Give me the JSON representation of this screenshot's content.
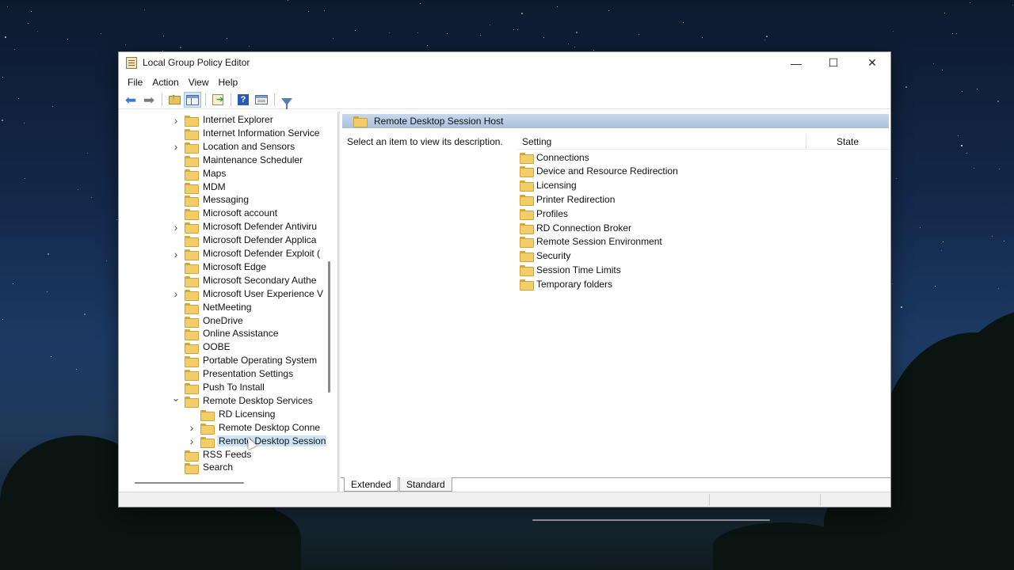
{
  "window": {
    "title": "Local Group Policy Editor",
    "controls": {
      "minimize": "—",
      "maximize": "☐",
      "close": "✕"
    }
  },
  "menu": [
    "File",
    "Action",
    "View",
    "Help"
  ],
  "toolbar": {
    "icons": [
      "back-arrow-icon",
      "forward-arrow-icon",
      "up-one-level-icon",
      "show-hide-console-tree-icon",
      "export-list-icon",
      "help-icon",
      "properties-icon",
      "filter-icon"
    ]
  },
  "tree": {
    "items": [
      {
        "label": "Internet Explorer",
        "expandable": true,
        "level": 1
      },
      {
        "label": "Internet Information Service",
        "expandable": false,
        "level": 1
      },
      {
        "label": "Location and Sensors",
        "expandable": true,
        "level": 1
      },
      {
        "label": "Maintenance Scheduler",
        "expandable": false,
        "level": 1
      },
      {
        "label": "Maps",
        "expandable": false,
        "level": 1
      },
      {
        "label": "MDM",
        "expandable": false,
        "level": 1
      },
      {
        "label": "Messaging",
        "expandable": false,
        "level": 1
      },
      {
        "label": "Microsoft account",
        "expandable": false,
        "level": 1
      },
      {
        "label": "Microsoft Defender Antiviru",
        "expandable": true,
        "level": 1
      },
      {
        "label": "Microsoft Defender Applica",
        "expandable": false,
        "level": 1
      },
      {
        "label": "Microsoft Defender Exploit (",
        "expandable": true,
        "level": 1
      },
      {
        "label": "Microsoft Edge",
        "expandable": false,
        "level": 1
      },
      {
        "label": "Microsoft Secondary Authe",
        "expandable": false,
        "level": 1
      },
      {
        "label": "Microsoft User Experience V",
        "expandable": true,
        "level": 1
      },
      {
        "label": "NetMeeting",
        "expandable": false,
        "level": 1
      },
      {
        "label": "OneDrive",
        "expandable": false,
        "level": 1
      },
      {
        "label": "Online Assistance",
        "expandable": false,
        "level": 1
      },
      {
        "label": "OOBE",
        "expandable": false,
        "level": 1
      },
      {
        "label": "Portable Operating System",
        "expandable": false,
        "level": 1
      },
      {
        "label": "Presentation Settings",
        "expandable": false,
        "level": 1
      },
      {
        "label": "Push To Install",
        "expandable": false,
        "level": 1
      },
      {
        "label": "Remote Desktop Services",
        "expandable": true,
        "expanded": true,
        "level": 1
      },
      {
        "label": "RD Licensing",
        "expandable": false,
        "level": 2
      },
      {
        "label": "Remote Desktop Conne",
        "expandable": true,
        "level": 2
      },
      {
        "label": "Remote Desktop Session",
        "expandable": true,
        "level": 2,
        "selected": true
      },
      {
        "label": "RSS Feeds",
        "expandable": false,
        "level": 1
      },
      {
        "label": "Search",
        "expandable": false,
        "level": 1
      }
    ]
  },
  "details": {
    "node_title": "Remote Desktop Session Host",
    "description": "Select an item to view its description.",
    "columns": {
      "setting": "Setting",
      "state": "State"
    },
    "items": [
      "Connections",
      "Device and Resource Redirection",
      "Licensing",
      "Printer Redirection",
      "Profiles",
      "RD Connection Broker",
      "Remote Session Environment",
      "Security",
      "Session Time Limits",
      "Temporary folders"
    ]
  },
  "tabs": [
    "Extended",
    "Standard"
  ],
  "active_tab": "Extended",
  "colors": {
    "selection": "#cde4f7",
    "header_band": "#a9c0dc",
    "folder": "#f2cd68"
  }
}
